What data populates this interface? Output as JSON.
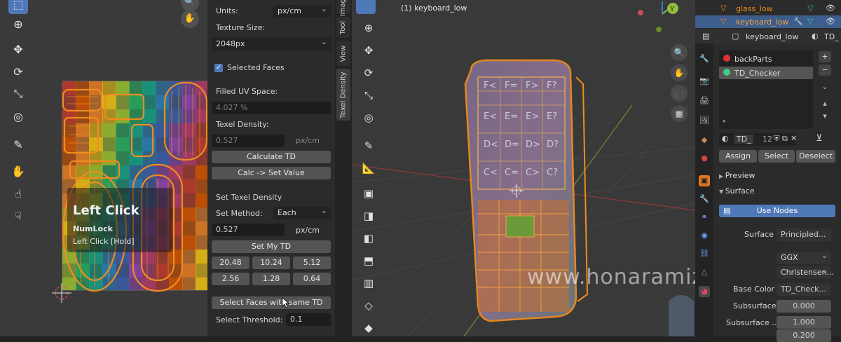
{
  "uv_panel": {
    "units_label": "Units:",
    "units_value": "px/cm",
    "texture_size_label": "Texture Size:",
    "texture_size_value": "2048px",
    "selected_faces_label": "Selected Faces",
    "filled_uv_label": "Filled UV Space:",
    "filled_uv_value": "4.027 %",
    "texel_density_label": "Texel Density:",
    "texel_density_value": "0.527",
    "texel_density_unit": "px/cm",
    "calculate_btn": "Calculate TD",
    "calc_set_btn": "Calc -> Set Value",
    "set_td_label": "Set Texel Density",
    "set_method_label": "Set Method:",
    "set_method_value": "Each",
    "set_value": "0.527",
    "set_value_unit": "px/cm",
    "set_my_td_btn": "Set My TD",
    "presets_row1": [
      "20.48",
      "10.24",
      "5.12"
    ],
    "presets_row2": [
      "2.56",
      "1.28",
      "0.64"
    ],
    "select_faces_btn": "Select Faces with same TD",
    "select_threshold_label": "Select Threshold:",
    "select_threshold_value": "0.1"
  },
  "key_overlay": {
    "main": "Left Click",
    "sub1": "NumLock",
    "sub2": "Left Click [Hold]"
  },
  "side_tabs": [
    "Image",
    "Tool",
    "View",
    "Texel Density"
  ],
  "viewport": {
    "object_label": "(1) keyboard_low"
  },
  "watermark": "www.honaramiz.com",
  "outliner": {
    "items": [
      "glass_low",
      "keyboard_low"
    ]
  },
  "properties": {
    "object_name": "keyboard_low",
    "material_short": "TD_",
    "materials": [
      "backParts",
      "TD_Checker"
    ],
    "slot_name": "TD_",
    "slot_users": "12",
    "assign_btn": "Assign",
    "select_btn": "Select",
    "deselect_btn": "Deselect",
    "preview_label": "Preview",
    "surface_label": "Surface",
    "use_nodes_btn": "Use Nodes",
    "surface_field_label": "Surface",
    "surface_field_value": "Principled...",
    "distribution_value": "GGX",
    "subsurface_method_value": "Christensen...",
    "base_color_label": "Base Color",
    "base_color_value": "TD_Check...",
    "subsurface_label": "Subsurface",
    "subsurface_value": "0.000",
    "subsurface_radius_label": "Subsurface ...",
    "subsurface_radius_value": "1.000",
    "subsurface_radius_value2": "0.200"
  },
  "colors": {
    "accent": "#4f78b8",
    "orange": "#f08c1e",
    "selected_row": "#3d5d8c"
  }
}
